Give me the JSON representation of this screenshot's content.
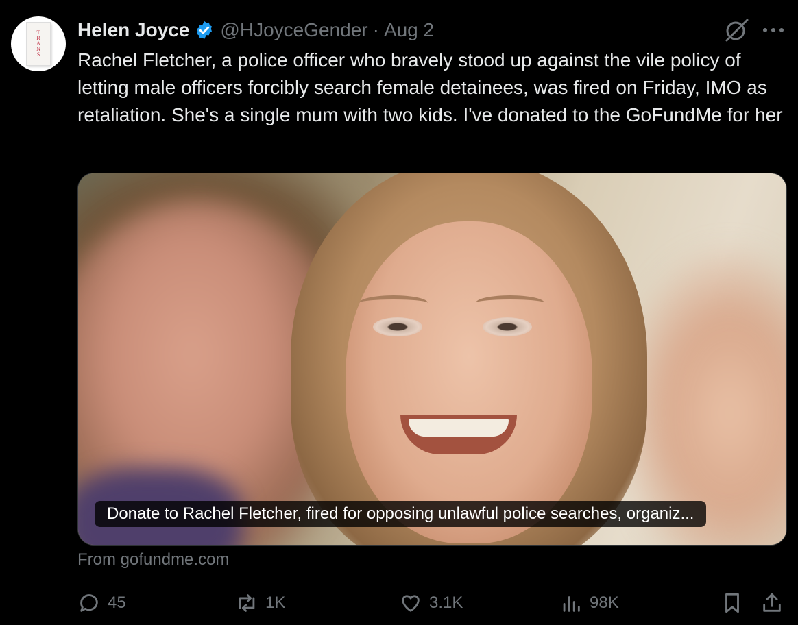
{
  "tweet": {
    "author_name": "Helen Joyce",
    "handle": "@HJoyceGender",
    "separator": "·",
    "date": "Aug 2",
    "text": "Rachel Fletcher, a police officer who bravely stood up against the vile policy of letting male officers forcibly search female detainees, was fired on Friday, IMO as retaliation. She's a single mum with two kids. I've donated to the GoFundMe for her"
  },
  "avatar": {
    "book_letters": [
      "T",
      "R",
      "A",
      "N",
      "S"
    ]
  },
  "card": {
    "caption": "Donate to Rachel Fletcher, fired for opposing unlawful police searches, organiz...",
    "source": "From gofundme.com"
  },
  "actions": {
    "replies": "45",
    "retweets": "1K",
    "likes": "3.1K",
    "views": "98K"
  },
  "icons": {
    "verified": "verified-badge-icon",
    "grok": "grok-icon",
    "more": "more-icon",
    "reply": "reply-icon",
    "retweet": "retweet-icon",
    "like": "heart-icon",
    "views": "views-icon",
    "bookmark": "bookmark-icon",
    "share": "share-icon"
  },
  "colors": {
    "background": "#000000",
    "text": "#e7e9ea",
    "muted": "#71767b",
    "verified": "#1d9bf0"
  }
}
